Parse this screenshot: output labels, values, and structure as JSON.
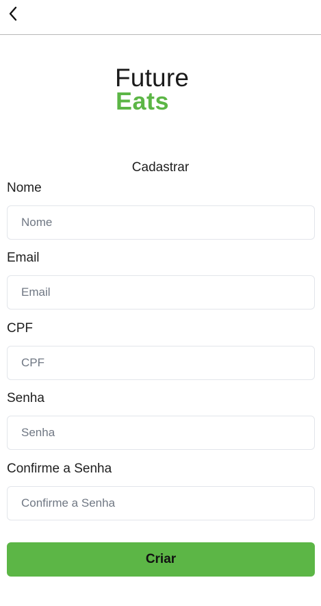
{
  "header": {
    "back_icon": "chevron-left-icon"
  },
  "logo": {
    "line1": "Future",
    "line2": "Eats",
    "accent_color": "#5cb646"
  },
  "form": {
    "title": "Cadastrar",
    "fields": [
      {
        "label": "Nome",
        "placeholder": "Nome",
        "value": ""
      },
      {
        "label": "Email",
        "placeholder": "Email",
        "value": ""
      },
      {
        "label": "CPF",
        "placeholder": "CPF",
        "value": ""
      },
      {
        "label": "Senha",
        "placeholder": "Senha",
        "value": ""
      },
      {
        "label": "Confirme a Senha",
        "placeholder": "Confirme a Senha",
        "value": ""
      }
    ],
    "submit_label": "Criar",
    "button_color": "#5cb646"
  }
}
